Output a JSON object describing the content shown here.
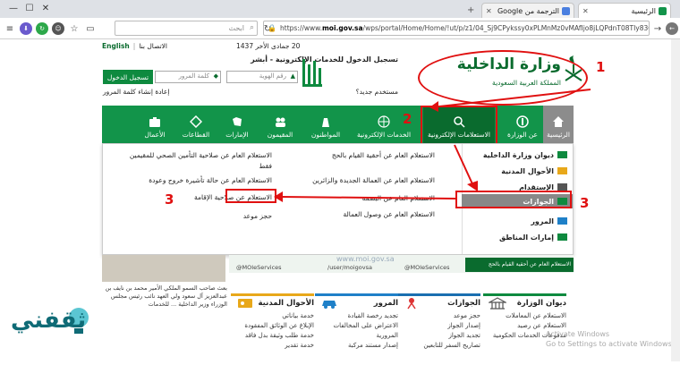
{
  "browser": {
    "tabs": [
      {
        "label": "الرئيسية",
        "active": true
      },
      {
        "label": "الترجمة من Google",
        "active": false
      }
    ],
    "new_tab": "+",
    "window_controls": [
      "—",
      "☐",
      "✕"
    ],
    "search_placeholder": "ابحث",
    "url_prefix": "https://www.",
    "url_domain": "moi.gov.sa",
    "url_rest": "/wps/portal/Home/Home/!ut/p/z1/04_Sj9CPykssy0xPLMnMz0vMAfIjo8jLQPdnT08TIy83Q0dzQwcPc2N_A0E"
  },
  "header": {
    "lang": "English",
    "contact": "الاتصال بنا",
    "date": "20 جمادى الأخر 1437",
    "login": {
      "title": "تسجيل الدخول للخدمات الإلكترونية - أبشر",
      "id_placeholder": "رقم الهوية",
      "password_placeholder": "كلمة المرور",
      "login_button": "تسجيل الدخول",
      "new_user": "مستخدم جديد؟",
      "reset_password": "إعادة إنشاء كلمة المرور"
    },
    "logo": {
      "title": "وزارة الداخلية",
      "subtitle": "المملكة العربية السعودية"
    }
  },
  "annotations": [
    "1",
    "2",
    "3",
    "3"
  ],
  "nav": {
    "items": [
      {
        "label": "الرئيسية",
        "icon": "home-icon"
      },
      {
        "label": "عن الوزارة",
        "icon": "emblem-icon"
      },
      {
        "label": "الاستعلامات الإلكترونية",
        "icon": "inquiry-icon"
      },
      {
        "label": "الخدمات الإلكترونية",
        "icon": "globe-icon"
      },
      {
        "label": "المواطنون",
        "icon": "citizen-icon"
      },
      {
        "label": "المقيمون",
        "icon": "residents-icon"
      },
      {
        "label": "الإمارات",
        "icon": "map-icon"
      },
      {
        "label": "القطاعات",
        "icon": "sectors-icon"
      },
      {
        "label": "الأعمال",
        "icon": "briefcase-icon"
      }
    ]
  },
  "menu": {
    "side": [
      {
        "label": "ديوان وزارة الداخلية"
      },
      {
        "label": "الأحوال المدنية"
      },
      {
        "label": "الإستقدام"
      },
      {
        "label": "الجوازات"
      },
      {
        "label": "المرور"
      },
      {
        "label": "إمارات المناطق"
      }
    ],
    "col1": [
      "الاستعلام العام عن أحقية القيام بالحج",
      "الاستعلام العام عن العمالة الجديدة والزائرين",
      "الاستعلام العام عن البصمة",
      "الاستعلام العام عن وصول العمالة"
    ],
    "col2": [
      "الاستعلام العام عن صلاحية التأمين الصحي للمقيمين",
      "فقط",
      "الاستعلام العام عن حالة تأشيرة خروج وعودة",
      "الاستعلام عن صلاحية الإقامة",
      "حجز موعد"
    ]
  },
  "banner": {
    "strip": "الاستعلام العام عن أحقية القيام بالحج",
    "social": [
      "@MOIeServices",
      "/user/moigovsa",
      "@MOIeServices"
    ],
    "site": "www.moi.gov.sa"
  },
  "news": "بعث صاحب السمو الملكي الأمير محمد بن نايف بن عبدالعزيز آل سعود ولي العهد نائب رئيس مجلس الوزراء وزير الداخلية ... للخدمات",
  "columns": [
    {
      "title": "ديوان الوزارة",
      "color": "#0e8a3f",
      "icon": "ministry-icon",
      "items": [
        "الاستعلام عن المعاملات",
        "الاستعلام عن رصيد",
        "مدفوعات الخدمات الحكومية"
      ]
    },
    {
      "title": "الجوازات",
      "color": "#1a6fb0",
      "icon": "passport-icon",
      "items": [
        "حجز موعد",
        "إصدار الجواز",
        "تجديد الجواز",
        "تصاريح السفر للتابعين"
      ]
    },
    {
      "title": "المرور",
      "color": "#1f80c8",
      "icon": "car-icon",
      "items": [
        "تجديد رخصة القيادة",
        "الاعتراض على المخالفات",
        "المرورية",
        "إصدار مستند مركبة"
      ]
    },
    {
      "title": "الأحوال المدنية",
      "color": "#e8a81a",
      "icon": "id-card-icon",
      "items": [
        "خدمة بياناتي",
        "الإبلاغ عن الوثائق المفقودة",
        "خدمة طلب وثيقة بدل فاقد",
        "خدمة تقدير"
      ]
    }
  ],
  "watermark": "ثقفني",
  "activate_windows": [
    "Activate Windows",
    "Go to Settings to activate Windows."
  ]
}
